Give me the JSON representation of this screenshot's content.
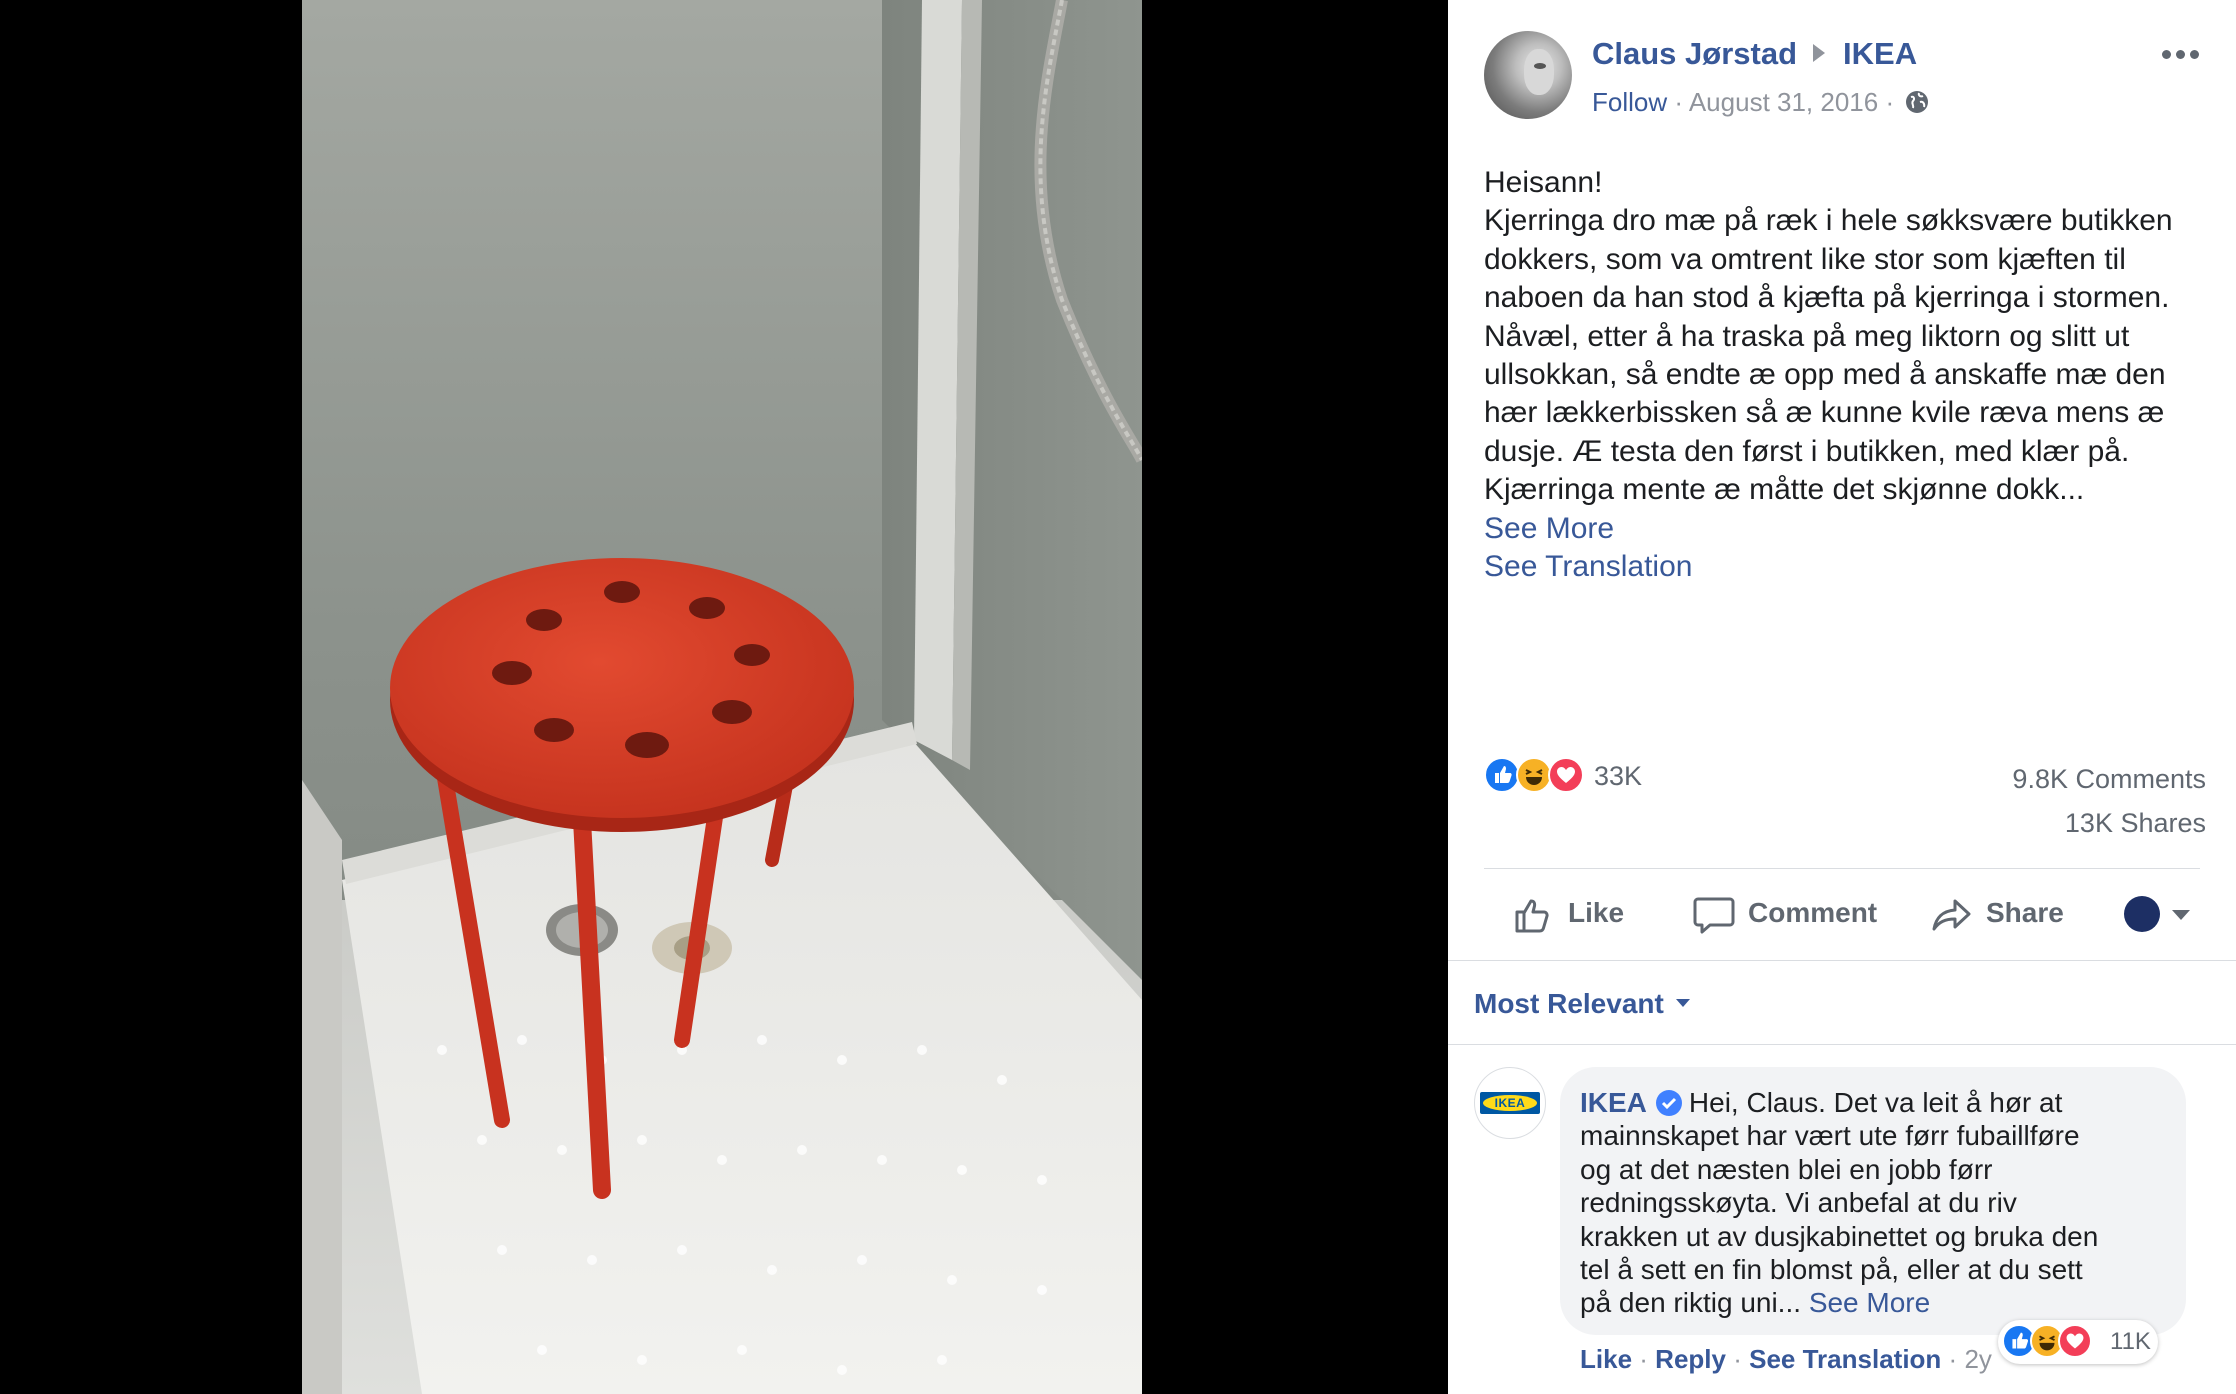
{
  "post": {
    "author": "Claus Jørstad",
    "page": "IKEA",
    "follow_label": "Follow",
    "separator": "·",
    "date": "August 31, 2016",
    "body_lines": [
      "Heisann!",
      "Kjerringa dro mæ på ræk i hele søkksvære butikken",
      "dokkers, som va omtrent like stor som kjæften til",
      "naboen da han stod å kjæfta på kjerringa i stormen.",
      "Nåvæl, etter å ha traska på meg liktorn og slitt ut",
      "ullsokkan, så endte æ opp med å anskaffe mæ den",
      "hær lækkerbissken så æ kunne kvile ræva mens æ",
      "dusje. Æ testa den først i butikken, med klær på.",
      "Kjærringa mente æ måtte det skjønne dokk..."
    ],
    "see_more": "See More",
    "see_translation": "See Translation"
  },
  "stats": {
    "reactions": "33K",
    "comments": "9.8K Comments",
    "shares": "13K Shares"
  },
  "actions": {
    "like": "Like",
    "comment": "Comment",
    "share": "Share"
  },
  "comments": {
    "sort_label": "Most Relevant",
    "top": {
      "author": "IKEA",
      "logo_text": "IKEA",
      "text_lines": [
        "Hei, Claus. Det va leit å hør at",
        "mainnskapet har vært ute førr fubaillføre",
        "og at det næsten blei en jobb førr",
        "redningsskøyta. Vi anbefal at du riv",
        "krakken ut av dusjkabinettet og bruka den",
        "tel å sett en fin blomst på, eller at du sett",
        "på den riktig uni..."
      ],
      "first_line_rest": "Hei, Claus. Det va leit å hør at",
      "see_more": "See More",
      "like": "Like",
      "reply": "Reply",
      "see_translation": "See Translation",
      "age": "2y",
      "reactions": "11K"
    }
  },
  "colors": {
    "link_blue": "#385898",
    "like_blue": "#1877f2",
    "haha_yellow": "#f7b125",
    "love_red": "#f33e58",
    "stool_red": "#d63a24"
  },
  "icons": [
    "globe-icon",
    "more-options-icon",
    "like-reaction-icon",
    "haha-reaction-icon",
    "love-reaction-icon",
    "thumbs-up-icon",
    "comment-icon",
    "share-icon",
    "audience-selector-icon",
    "verified-badge-icon"
  ]
}
